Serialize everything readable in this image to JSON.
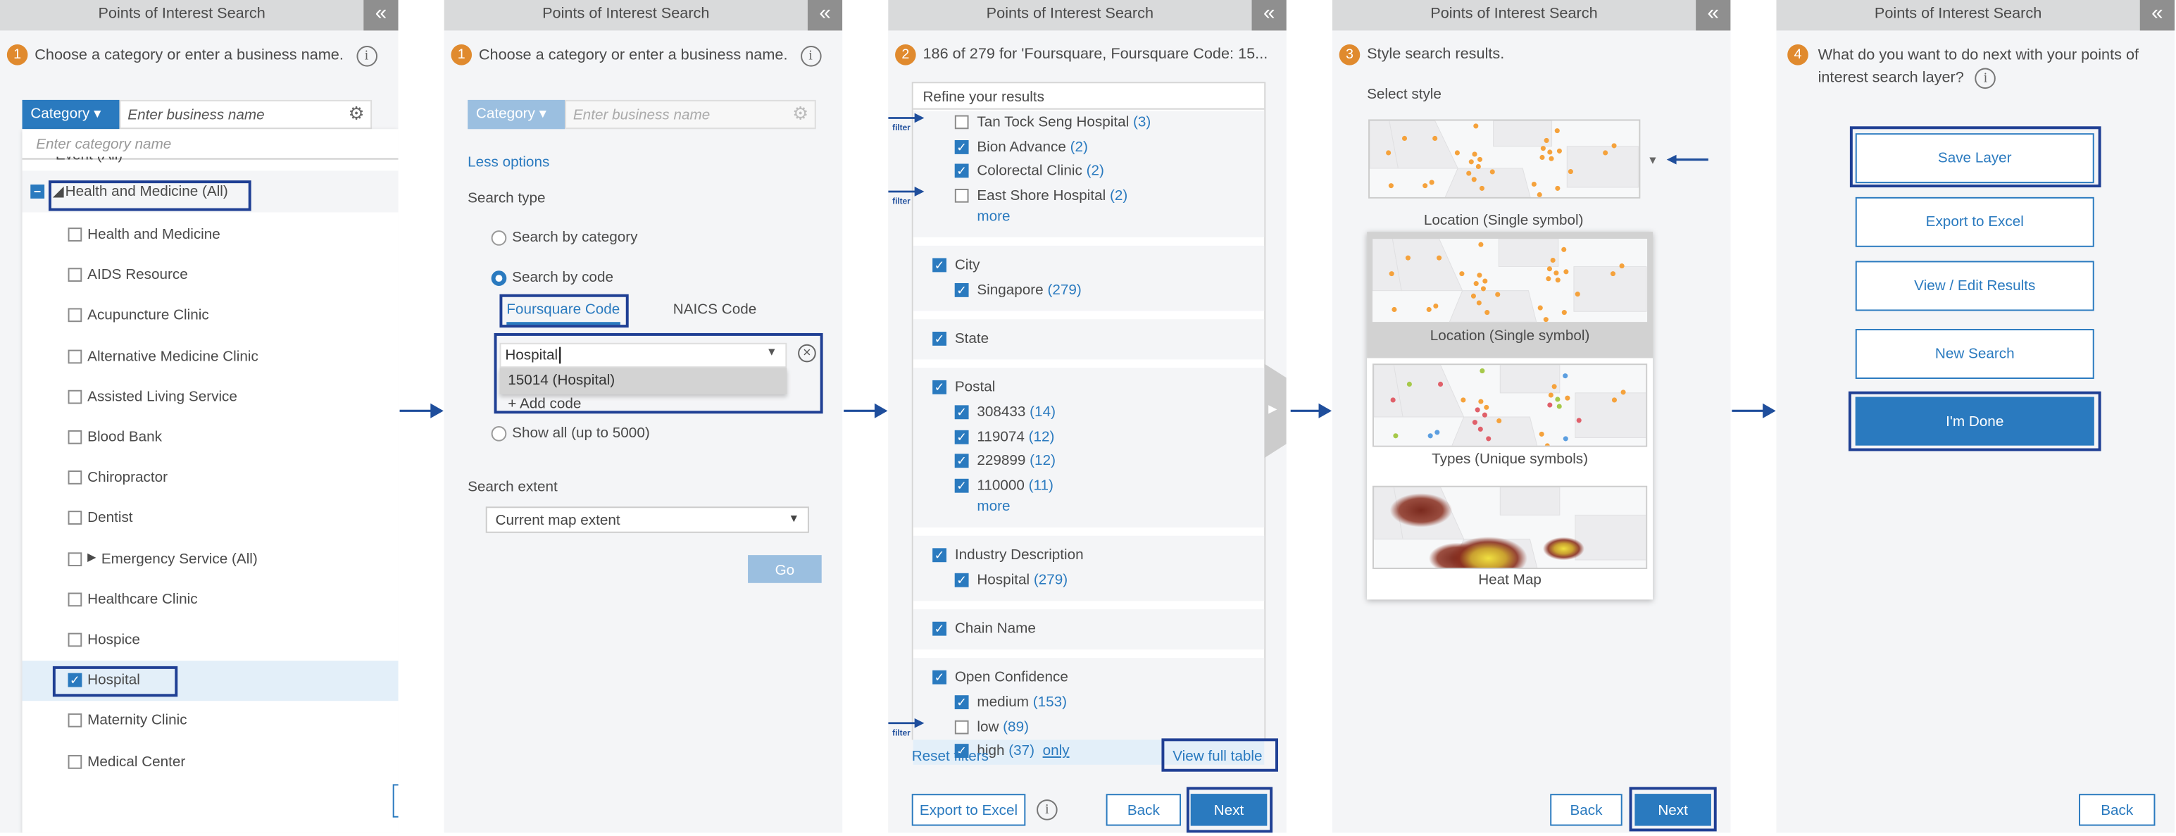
{
  "colors": {
    "accent": "#2a7abf",
    "step_badge": "#e08a2e",
    "callout": "#1f3f94",
    "header_bg": "#d9dadb",
    "collapse_bg": "#8f8f8f"
  },
  "app_title": "Points of Interest Search",
  "collapse_icon": "double-chevron-left-icon",
  "info_glyph": "i",
  "panel1": {
    "step": "1",
    "instruction": "Choose a category or enter a business name.",
    "category_button": "Category ▾",
    "business_placeholder": "Enter business name",
    "category_placeholder": "Enter category name",
    "partial_item": "Event (All)",
    "group": "Health and Medicine (All)",
    "items": [
      {
        "label": "Health and Medicine",
        "checked": false
      },
      {
        "label": "AIDS Resource",
        "checked": false
      },
      {
        "label": "Acupuncture Clinic",
        "checked": false
      },
      {
        "label": "Alternative Medicine Clinic",
        "checked": false
      },
      {
        "label": "Assisted Living Service",
        "checked": false
      },
      {
        "label": "Blood Bank",
        "checked": false
      },
      {
        "label": "Chiropractor",
        "checked": false
      },
      {
        "label": "Dentist",
        "checked": false
      },
      {
        "label": "Emergency Service (All)",
        "checked": false,
        "expandable": true
      },
      {
        "label": "Healthcare Clinic",
        "checked": false
      },
      {
        "label": "Hospice",
        "checked": false
      },
      {
        "label": "Hospital",
        "checked": true
      },
      {
        "label": "Maternity Clinic",
        "checked": false
      },
      {
        "label": "Medical Center",
        "checked": false
      }
    ]
  },
  "panel2": {
    "step": "1",
    "instruction": "Choose a category or enter a business name.",
    "category_button": "Category ▾",
    "business_placeholder": "Enter business name",
    "less_options": "Less options",
    "search_type_label": "Search type",
    "radios": [
      {
        "label": "Search by category",
        "selected": false
      },
      {
        "label": "Search by code",
        "selected": true
      },
      {
        "label": "Show all (up to 5000)",
        "selected": false
      }
    ],
    "tabs": [
      {
        "label": "Foursquare Code",
        "active": true
      },
      {
        "label": "NAICS Code",
        "active": false
      }
    ],
    "code_input_value": "Hospital",
    "suggestion": "15014 (Hospital)",
    "add_code": "Add code",
    "search_extent_label": "Search extent",
    "search_extent_value": "Current map extent",
    "go": "Go"
  },
  "panel3": {
    "step": "2",
    "summary": "186 of 279 for 'Foursquare, Foursquare Code: 15...",
    "refine_title": "Refine your results",
    "filter_label": "filter",
    "sections": [
      {
        "title": "",
        "items": [
          {
            "label": "Tan Tock Seng Hospital",
            "count": "(3)",
            "checked": false,
            "arrow": true
          },
          {
            "label": "Bion Advance",
            "count": "(2)",
            "checked": true
          },
          {
            "label": "Colorectal Clinic",
            "count": "(2)",
            "checked": true
          },
          {
            "label": "East Shore Hospital",
            "count": "(2)",
            "checked": false,
            "arrow": true
          }
        ],
        "more": "more"
      },
      {
        "title": "City",
        "items": [
          {
            "label": "Singapore",
            "count": "(279)",
            "checked": true
          }
        ]
      },
      {
        "title": "State",
        "items": []
      },
      {
        "title": "Postal",
        "items": [
          {
            "label": "308433",
            "count": "(14)",
            "checked": true
          },
          {
            "label": "119074",
            "count": "(12)",
            "checked": true
          },
          {
            "label": "229899",
            "count": "(12)",
            "checked": true
          },
          {
            "label": "110000",
            "count": "(11)",
            "checked": true
          }
        ],
        "more": "more"
      },
      {
        "title": "Industry Description",
        "items": [
          {
            "label": "Hospital",
            "count": "(279)",
            "checked": true
          }
        ]
      },
      {
        "title": "Chain Name",
        "items": []
      },
      {
        "title": "Open Confidence",
        "items": [
          {
            "label": "medium",
            "count": "(153)",
            "checked": true
          },
          {
            "label": "low",
            "count": "(89)",
            "checked": false,
            "arrow": true
          },
          {
            "label": "high",
            "count": "(37)",
            "checked": true,
            "only": "only",
            "hover": true
          }
        ]
      }
    ],
    "reset_filters": "Reset filters",
    "view_full_table": "View full table",
    "export": "Export to Excel",
    "back": "Back",
    "next": "Next"
  },
  "panel4": {
    "step": "3",
    "instruction": "Style search results.",
    "select_style": "Select style",
    "current_style": "Location (Single symbol)",
    "options": [
      {
        "label": "Location (Single symbol)",
        "selected": true
      },
      {
        "label": "Types (Unique symbols)",
        "selected": false
      },
      {
        "label": "Heat Map",
        "selected": false
      }
    ],
    "back": "Back",
    "next": "Next"
  },
  "panel5": {
    "step": "4",
    "question_line1": "What do you want to do next with your points of",
    "question_line2": "interest search layer?",
    "buttons": [
      "Save Layer",
      "Export to Excel",
      "View / Edit Results",
      "New Search",
      "I'm Done"
    ],
    "back": "Back"
  }
}
